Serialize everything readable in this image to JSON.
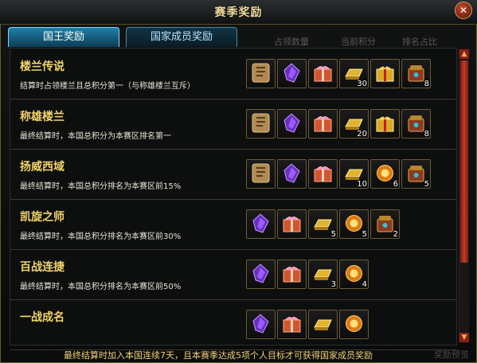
{
  "window": {
    "title": "赛季奖励",
    "close_label": "✕"
  },
  "tabs": [
    {
      "label": "国王奖励",
      "active": true
    },
    {
      "label": "国家成员奖励",
      "active": false
    }
  ],
  "columns": {
    "occupied": "占领数量",
    "current_score": "当前积分",
    "rank_ratio": "排名占比"
  },
  "rewards": [
    {
      "title": "楼兰传说",
      "desc": "结算时占领楼兰且总积分第一（与称雄楼兰互斥）",
      "items": [
        {
          "icon": "scroll-token-icon",
          "qty": ""
        },
        {
          "icon": "purple-crystal-icon",
          "qty": ""
        },
        {
          "icon": "gift-box-icon",
          "qty": ""
        },
        {
          "icon": "gold-bar-icon",
          "qty": "30"
        },
        {
          "icon": "gold-gift-box-icon",
          "qty": ""
        },
        {
          "icon": "ornate-box-icon",
          "qty": "8"
        }
      ]
    },
    {
      "title": "称雄楼兰",
      "desc": "最终结算时，本国总积分为本赛区排名第一",
      "items": [
        {
          "icon": "scroll-token-icon",
          "qty": ""
        },
        {
          "icon": "purple-crystal-icon",
          "qty": ""
        },
        {
          "icon": "gift-box-icon",
          "qty": ""
        },
        {
          "icon": "gold-bar-icon",
          "qty": "20"
        },
        {
          "icon": "gold-gift-box-icon",
          "qty": ""
        },
        {
          "icon": "ornate-box-icon",
          "qty": "8"
        }
      ]
    },
    {
      "title": "扬威西域",
      "desc": "最终结算时，本国总积分排名为本赛区前15%",
      "items": [
        {
          "icon": "scroll-token-icon",
          "qty": ""
        },
        {
          "icon": "purple-crystal-icon",
          "qty": ""
        },
        {
          "icon": "gift-box-icon",
          "qty": ""
        },
        {
          "icon": "gold-bar-icon",
          "qty": "10"
        },
        {
          "icon": "gold-orb-icon",
          "qty": "6"
        },
        {
          "icon": "ornate-box-icon",
          "qty": "5"
        }
      ]
    },
    {
      "title": "凯旋之师",
      "desc": "最终结算时，本国总积分排名为本赛区前30%",
      "items": [
        {
          "icon": "purple-crystal-icon",
          "qty": ""
        },
        {
          "icon": "gift-box-icon",
          "qty": ""
        },
        {
          "icon": "gold-bar-icon",
          "qty": "5"
        },
        {
          "icon": "gold-orb-icon",
          "qty": "5"
        },
        {
          "icon": "ornate-box-icon",
          "qty": "2"
        }
      ]
    },
    {
      "title": "百战连捷",
      "desc": "最终结算时，本国总积分排名为本赛区前50%",
      "items": [
        {
          "icon": "purple-crystal-icon",
          "qty": ""
        },
        {
          "icon": "gift-box-icon",
          "qty": ""
        },
        {
          "icon": "gold-bar-icon",
          "qty": "3"
        },
        {
          "icon": "gold-orb-icon",
          "qty": "4"
        }
      ]
    },
    {
      "title": "一战成名",
      "desc": "",
      "items": [
        {
          "icon": "purple-crystal-icon",
          "qty": ""
        },
        {
          "icon": "gift-box-icon",
          "qty": ""
        },
        {
          "icon": "gold-bar-icon",
          "qty": ""
        },
        {
          "icon": "gold-orb-icon",
          "qty": ""
        }
      ]
    }
  ],
  "footer": {
    "text": "最终结算时加入本国连续7天，且本赛季达成5项个人目标才可获得国家成员奖励",
    "button": "奖励预览"
  }
}
